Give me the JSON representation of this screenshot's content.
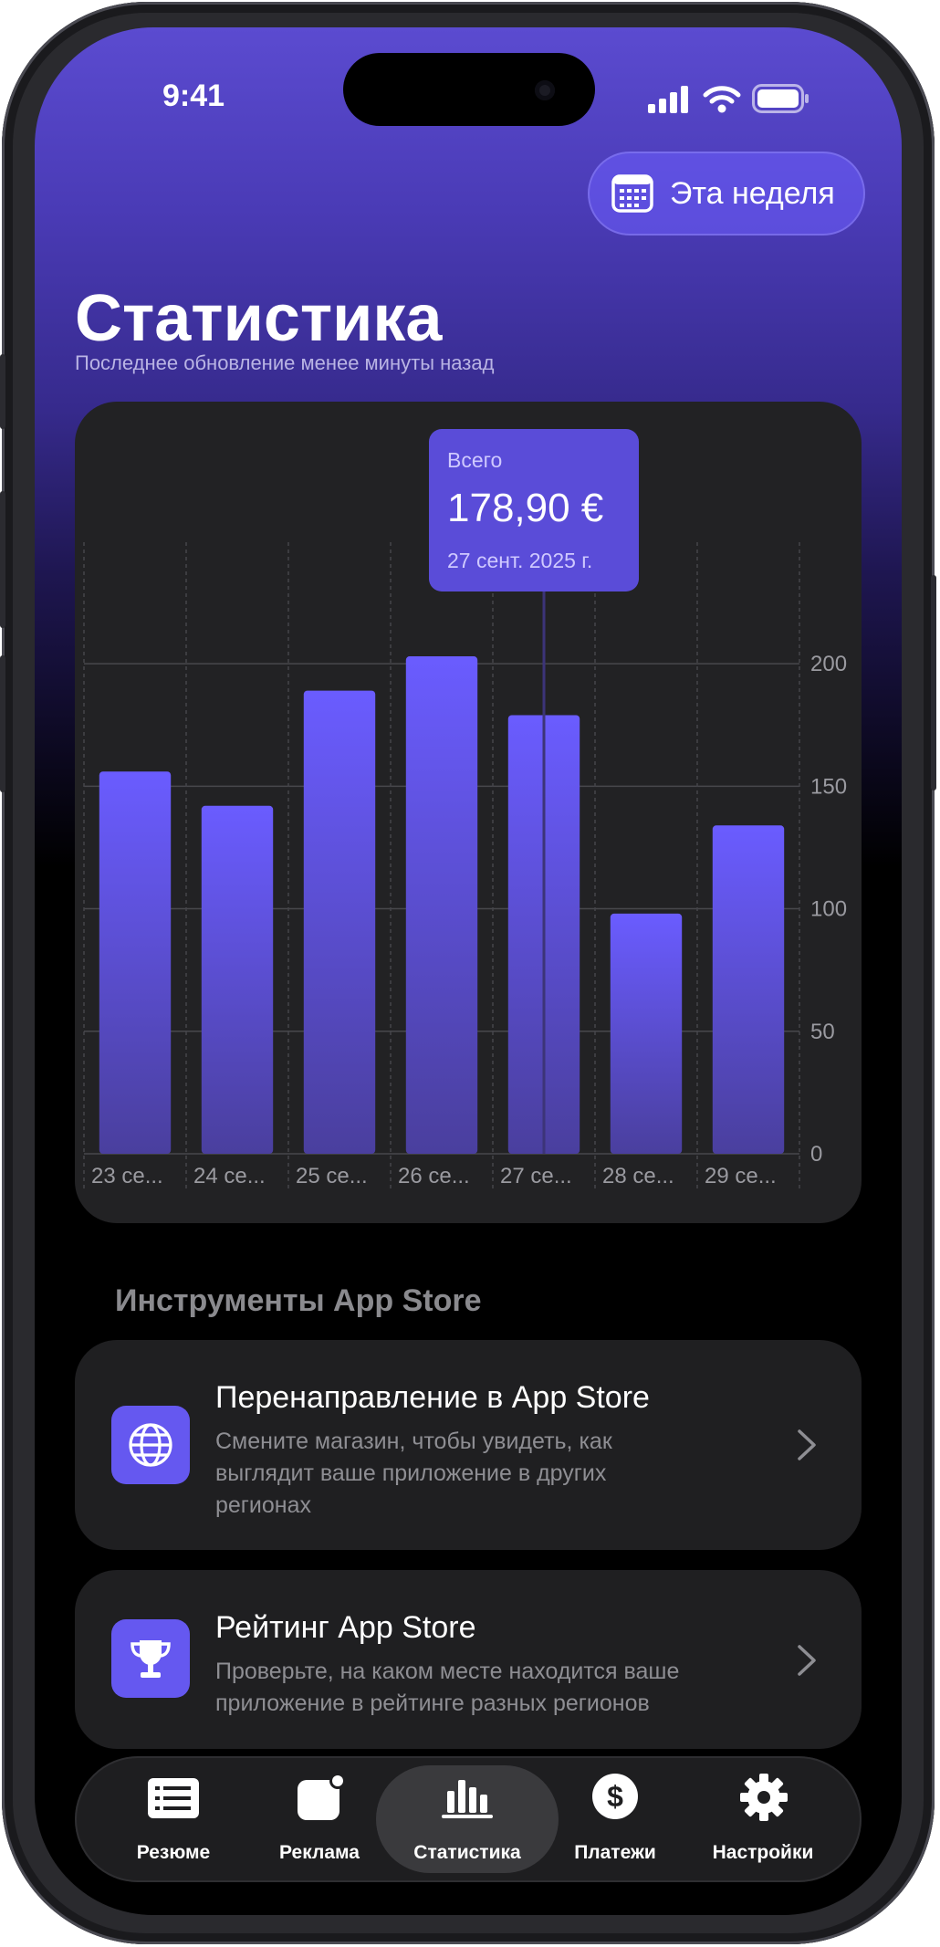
{
  "status_bar": {
    "time": "9:41"
  },
  "header": {
    "period_button": "Эта неделя",
    "title": "Статистика",
    "subtitle": "Последнее обновление менее минуты назад"
  },
  "tooltip": {
    "label": "Всего",
    "value": "178,90 €",
    "date": "27 сент. 2025 г."
  },
  "chart_data": {
    "type": "bar",
    "categories": [
      "23 се...",
      "24 се...",
      "25 се...",
      "26 се...",
      "27 се...",
      "28 се...",
      "29 се..."
    ],
    "values": [
      156,
      142,
      189,
      203,
      179,
      98,
      134
    ],
    "selected_index": 4,
    "ylim": [
      0,
      225
    ],
    "yticks": [
      0,
      50,
      100,
      150,
      200
    ],
    "grid": true,
    "bar_color": "#6a5cff",
    "title": "",
    "xlabel": "",
    "ylabel": ""
  },
  "tools": {
    "section_title": "Инструменты App Store",
    "items": [
      {
        "icon": "globe-icon",
        "title": "Перенаправление в App Store",
        "desc": "Смените магазин, чтобы увидеть, как выглядит ваше приложение в других регионах"
      },
      {
        "icon": "trophy-icon",
        "title": "Рейтинг App Store",
        "desc": "Проверьте, на каком месте находится ваше приложение в рейтинге разных регионов"
      }
    ]
  },
  "tab_bar": {
    "active_index": 2,
    "items": [
      {
        "label": "Резюме",
        "icon": "list-icon"
      },
      {
        "label": "Реклама",
        "icon": "ad-badge-icon"
      },
      {
        "label": "Статистика",
        "icon": "bar-chart-icon"
      },
      {
        "label": "Платежи",
        "icon": "dollar-icon"
      },
      {
        "label": "Настройки",
        "icon": "gear-icon"
      }
    ]
  },
  "colors": {
    "accent": "#6558f0",
    "header_gradient_top": "#5b4bd0",
    "card_bg": "#222224"
  }
}
